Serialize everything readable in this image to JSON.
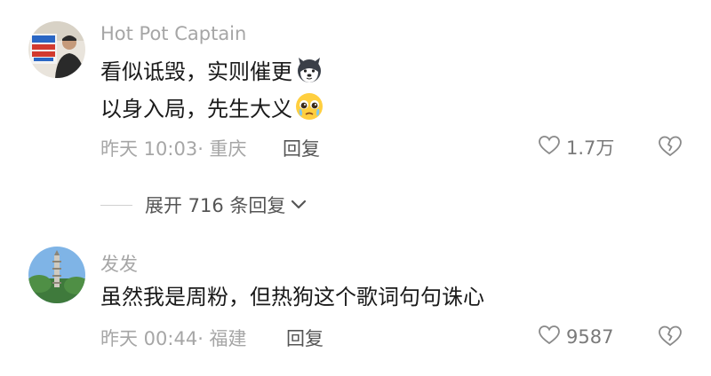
{
  "comments": [
    {
      "username": "Hot Pot Captain",
      "lines": [
        "看似诋毁，实则催更",
        "以身入局，先生大义"
      ],
      "emoji_icons": [
        "husky-dog-emoji-icon",
        "pleading-face-emoji-icon"
      ],
      "meta": "昨天 10:03· 重庆",
      "reply_label": "回复",
      "like_count": "1.7万"
    },
    {
      "username": "发发",
      "lines": [
        "虽然我是周粉，但热狗这个歌词句句诛心"
      ],
      "meta": "昨天 00:44· 福建",
      "reply_label": "回复",
      "like_count": "9587"
    }
  ],
  "expand_replies_label": "展开 716 条回复",
  "colors": {
    "text_primary": "#1a1a1a",
    "text_secondary": "#a6a6a6",
    "text_action": "#555555"
  }
}
